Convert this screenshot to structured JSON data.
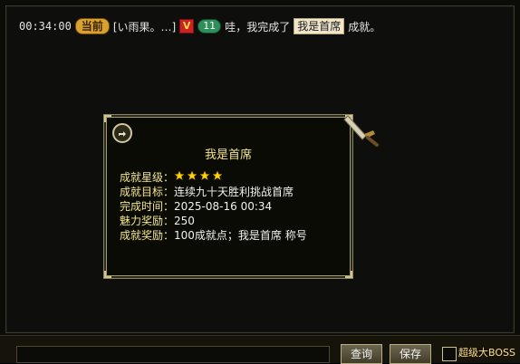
{
  "colors": {
    "chat_text": "#e4e4e4",
    "tooltip_key": "#f2e58a",
    "tooltip_value": "#f0f0f0",
    "pill_bg": "#d8a232",
    "vip_bg": "#cc2222",
    "lvl_bg": "#2f8f5a",
    "star": "#ffd200"
  },
  "chat": {
    "time": "00:34:00",
    "channel": "当前",
    "player": "[い雨果。…]",
    "vip_badge": "V",
    "level_badge": "11",
    "message_prefix": "哇，我完成了",
    "achievement_title": "我是首席",
    "message_suffix": "成就。"
  },
  "tooltip": {
    "title": "我是首席",
    "rows": [
      {
        "label": "成就星级：",
        "value": ""
      },
      {
        "label": "成就目标：",
        "value": "连续九十天胜利挑战首席"
      },
      {
        "label": "完成时间：",
        "value": "2025-08-16 00:34"
      },
      {
        "label": "魅力奖励：",
        "value": "250"
      },
      {
        "label": "成就奖励：",
        "value": "100成就点；我是首席 称号"
      }
    ],
    "stars": 4,
    "share_icon": "share-arrow-icon",
    "decoration_icon": "sword-icon"
  },
  "bottom": {
    "query_label": "查询",
    "save_label": "保存",
    "super_boss_label": "超级大BOSS"
  }
}
